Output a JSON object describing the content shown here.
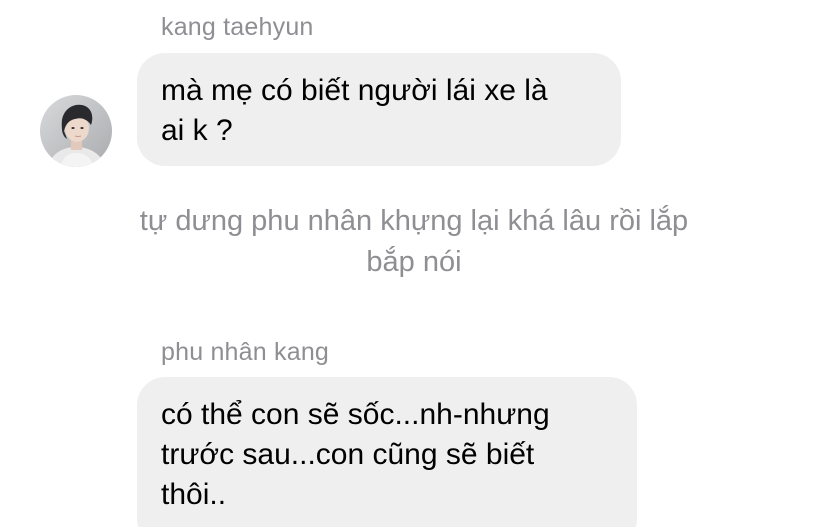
{
  "messages": [
    {
      "sender": "kang taehyun",
      "lines": [
        "mà mẹ có biết người lái xe là",
        "ai k ?"
      ]
    },
    {
      "sender": "phu nhân kang",
      "lines": [
        "có thể con sẽ sốc...nh-nhưng",
        "trước sau...con cũng sẽ biết",
        "thôi.."
      ]
    }
  ],
  "narration": {
    "lines": [
      "tự dưng phu nhân khựng lại khá lâu rồi lắp",
      "bắp nói"
    ]
  },
  "avatar": {
    "icon": "person-photo"
  },
  "colors": {
    "bubble": "#efeff0",
    "meta_text": "#8e8e93",
    "message_text": "#000000",
    "background": "#ffffff"
  }
}
